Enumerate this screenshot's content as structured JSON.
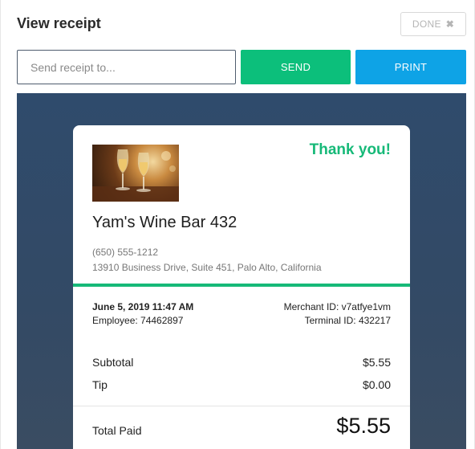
{
  "header": {
    "title": "View receipt",
    "done_label": "DONE",
    "done_icon": "close-icon"
  },
  "send": {
    "placeholder": "Send receipt to...",
    "value": "",
    "send_label": "SEND",
    "print_label": "PRINT"
  },
  "colors": {
    "send": "#0cbf7b",
    "print": "#0ea3e6",
    "accent": "#16b978",
    "preview_bg": "#2f4b6c"
  },
  "receipt": {
    "thank_you": "Thank you!",
    "merchant_name": "Yam's Wine Bar 432",
    "phone": "(650) 555-1212",
    "address": "13910 Business Drive, Suite 451, Palo Alto, California",
    "datetime": "June 5, 2019 11:47 AM",
    "employee": "Employee: 74462897",
    "merchant_id": "Merchant ID: v7atfye1vm",
    "terminal_id": "Terminal ID: 432217",
    "subtotal_label": "Subtotal",
    "subtotal_value": "$5.55",
    "tip_label": "Tip",
    "tip_value": "$0.00",
    "total_label": "Total Paid",
    "total_value": "$5.55"
  }
}
